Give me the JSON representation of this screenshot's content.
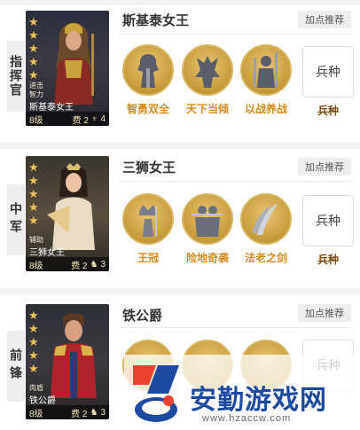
{
  "sections": [
    {
      "position_label": "指挥官",
      "hero_name": "斯基泰女王",
      "recommend_label": "加点推荐",
      "portrait": {
        "stars": 5,
        "traits": [
          "进击",
          "智力"
        ],
        "name": "斯基泰女王",
        "level": "8级",
        "cost": "费 2",
        "troop_count": "4"
      },
      "skills": [
        "智勇双全",
        "天下当倾",
        "以战养战"
      ],
      "troop_box": "兵种",
      "troop_label": "兵种"
    },
    {
      "position_label": "中军",
      "hero_name": "三狮女王",
      "recommend_label": "加点推荐",
      "portrait": {
        "stars": 5,
        "traits": [
          "辅助"
        ],
        "name": "三狮女王",
        "level": "8级",
        "cost": "费 2",
        "troop_count": "3"
      },
      "skills": [
        "王冠",
        "险地奇袭",
        "法老之剑"
      ],
      "troop_box": "兵种",
      "troop_label": "兵种"
    },
    {
      "position_label": "前锋",
      "hero_name": "铁公爵",
      "recommend_label": "加点推荐",
      "portrait": {
        "stars": 5,
        "traits": [
          "肉盾"
        ],
        "name": "铁公爵",
        "level": "8级",
        "cost": "费 2",
        "troop_count": "3"
      },
      "skills": [],
      "troop_box": "兵种",
      "troop_label": ""
    }
  ],
  "watermark": {
    "title": "安勤游戏网",
    "url": "www.hzaccw.com"
  }
}
